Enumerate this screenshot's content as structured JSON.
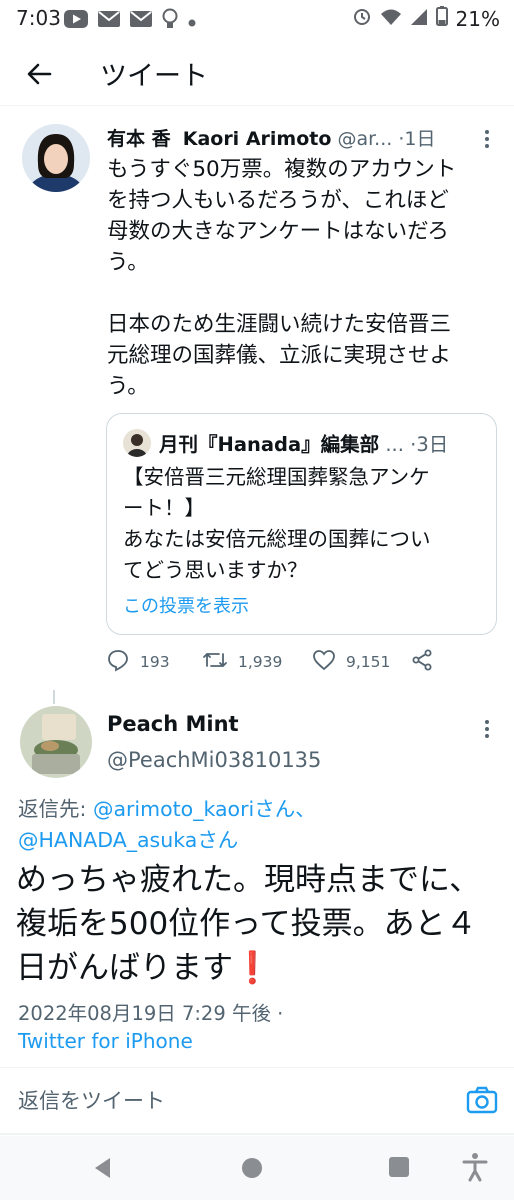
{
  "status_bar": {
    "time": "7:03",
    "battery": "21%"
  },
  "header": {
    "title": "ツイート"
  },
  "quoted_parent": {
    "name": "有本 香",
    "name_latin": "Kaori Arimoto",
    "handle": "@ar...",
    "separator": "·",
    "time": "1日",
    "body": "もうすぐ50万票。複数のアカウント\nを持つ人もいるだろうが、これほど\n母数の大きなアンケートはないだろ\nう。\n\n日本のため生涯闘い続けた安倍晋三\n元総理の国葬儀、立派に実現させよ\nう。",
    "quote": {
      "name": "月刊『Hanada』編集部",
      "ellipsis": "...",
      "separator": "·",
      "time": "3日",
      "body": "【安倍晋三元総理国葬緊急アンケ\nート！】\nあなたは安倍元総理の国葬につい\nてどう思いますか？",
      "link": "この投票を表示"
    },
    "actions": {
      "replies": "193",
      "retweets": "1,939",
      "likes": "9,151"
    }
  },
  "tweet": {
    "name": "Peach Mint",
    "handle": "@PeachMi03810135",
    "reply_prefix": "返信先: ",
    "mention1": "@arimoto_kaori",
    "suffix1": "さん、",
    "mention2": "@HANADA_asuka",
    "suffix2": "さん",
    "body": "めっちゃ疲れた。現時点までに、複垢を500位作って投票。あと４日がんばります",
    "emoji": "❗",
    "timestamp": "2022年08月19日 7:29 午後 ·",
    "source": "Twitter for iPhone"
  },
  "reply_bar": {
    "placeholder": "返信をツイート"
  },
  "colors": {
    "accent": "#1d9bf0",
    "text": "#0f1419",
    "muted": "#536471",
    "border": "#cfd9de"
  }
}
